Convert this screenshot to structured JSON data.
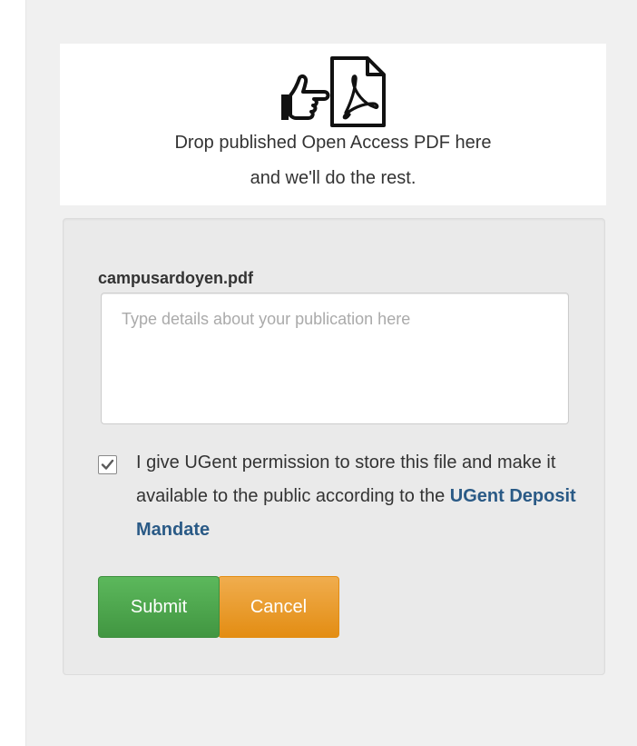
{
  "dropzone": {
    "line1": "Drop published Open Access PDF here",
    "line2": "and we'll do the rest.",
    "icons": [
      "hand-pointing-right-icon",
      "pdf-file-icon"
    ]
  },
  "form": {
    "file_name": "campusardoyen.pdf",
    "details": {
      "value": "",
      "placeholder": "Type details about your publication here"
    },
    "permission": {
      "checked": true,
      "text": "I give UGent permission to store this file and make it available to the public according to the",
      "link_text": "UGent Deposit Mandate"
    },
    "submit_label": "Submit",
    "cancel_label": "Cancel"
  },
  "colors": {
    "submit": "#5cb85c",
    "cancel": "#f0ad4e",
    "link": "#2a5a86",
    "panel_background": "#f0f0f0"
  }
}
